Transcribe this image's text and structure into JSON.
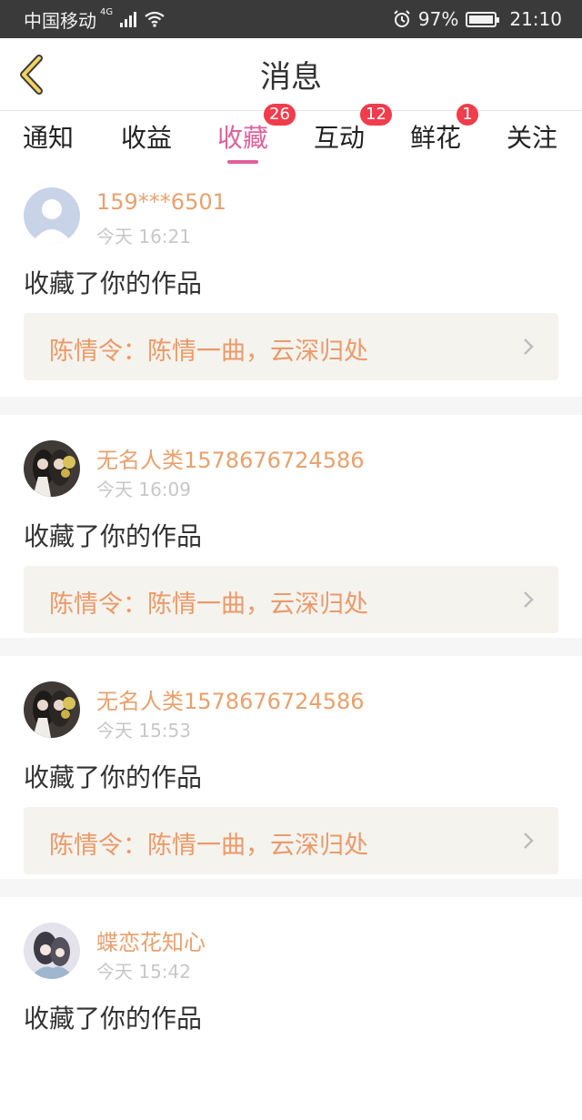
{
  "status_bar": {
    "carrier": "中国移动",
    "network": "4G",
    "battery": "97%",
    "time": "21:10"
  },
  "header": {
    "title": "消息"
  },
  "tabs": [
    {
      "label": "通知",
      "badge": ""
    },
    {
      "label": "收益",
      "badge": ""
    },
    {
      "label": "收藏",
      "badge": "26",
      "active": true
    },
    {
      "label": "互动",
      "badge": "12"
    },
    {
      "label": "鲜花",
      "badge": "1"
    },
    {
      "label": "关注",
      "badge": ""
    }
  ],
  "items": [
    {
      "user": "159***6501",
      "time": "今天 16:21",
      "action": "收藏了你的作品",
      "work": "陈情令：陈情一曲，云深归处"
    },
    {
      "user": "无名人类1578676724586",
      "time": "今天 16:09",
      "action": "收藏了你的作品",
      "work": "陈情令：陈情一曲，云深归处"
    },
    {
      "user": "无名人类1578676724586",
      "time": "今天 15:53",
      "action": "收藏了你的作品",
      "work": "陈情令：陈情一曲，云深归处"
    },
    {
      "user": "蝶恋花知心",
      "time": "今天 15:42",
      "action": "收藏了你的作品",
      "work": ""
    }
  ],
  "colors": {
    "accent": "#e0609b",
    "badge": "#f03c4b",
    "username": "#e8a16d",
    "work_title": "#eb9a69"
  }
}
